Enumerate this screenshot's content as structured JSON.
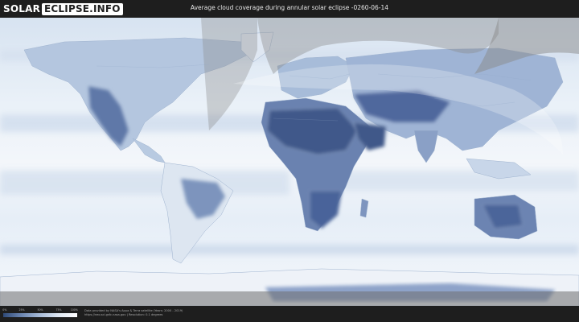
{
  "header": {
    "logo_part1": "SOLAR",
    "logo_part2": "ECLIPSE.INFO",
    "title": "Average cloud coverage during annular solar eclipse -0260-06-14"
  },
  "legend": {
    "ticks": [
      "0%",
      "25%",
      "50%",
      "75%",
      "100%"
    ],
    "gradient_colors": [
      "#2f4a78",
      "#6d87b2",
      "#a9bcd8",
      "#dfe8f3",
      "#ffffff"
    ]
  },
  "credits": {
    "line1": "Data provided by NASA's Aqua & Terra satellite (Years: 2000 - 2019)",
    "line2": "https://neo.sci.gsfc.nasa.gov  |  Resolution: 0.1 degrees"
  },
  "map": {
    "night_shade_color": "#8a8a8a",
    "ocean_cloud_color": "#e8eff8",
    "clear_sky_color": "#5a74a6"
  }
}
